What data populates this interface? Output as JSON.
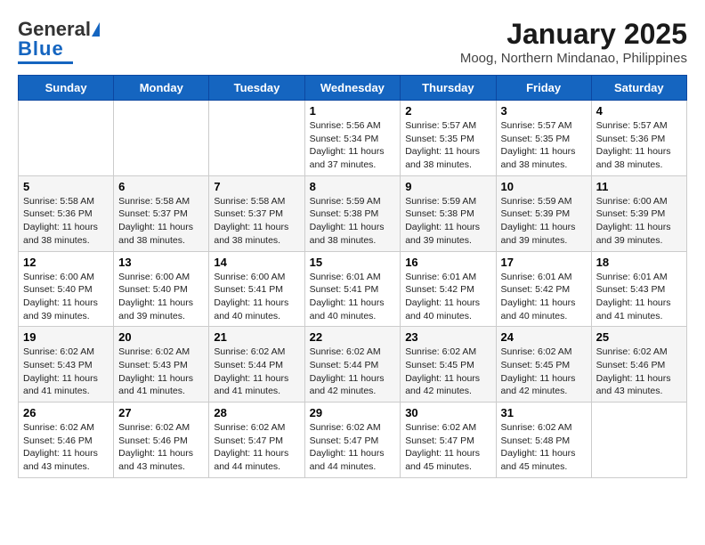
{
  "header": {
    "logo_general": "General",
    "logo_blue": "Blue",
    "title": "January 2025",
    "subtitle": "Moog, Northern Mindanao, Philippines"
  },
  "days_of_week": [
    "Sunday",
    "Monday",
    "Tuesday",
    "Wednesday",
    "Thursday",
    "Friday",
    "Saturday"
  ],
  "weeks": [
    [
      {
        "day": "",
        "info": ""
      },
      {
        "day": "",
        "info": ""
      },
      {
        "day": "",
        "info": ""
      },
      {
        "day": "1",
        "info": "Sunrise: 5:56 AM\nSunset: 5:34 PM\nDaylight: 11 hours\nand 37 minutes."
      },
      {
        "day": "2",
        "info": "Sunrise: 5:57 AM\nSunset: 5:35 PM\nDaylight: 11 hours\nand 38 minutes."
      },
      {
        "day": "3",
        "info": "Sunrise: 5:57 AM\nSunset: 5:35 PM\nDaylight: 11 hours\nand 38 minutes."
      },
      {
        "day": "4",
        "info": "Sunrise: 5:57 AM\nSunset: 5:36 PM\nDaylight: 11 hours\nand 38 minutes."
      }
    ],
    [
      {
        "day": "5",
        "info": "Sunrise: 5:58 AM\nSunset: 5:36 PM\nDaylight: 11 hours\nand 38 minutes."
      },
      {
        "day": "6",
        "info": "Sunrise: 5:58 AM\nSunset: 5:37 PM\nDaylight: 11 hours\nand 38 minutes."
      },
      {
        "day": "7",
        "info": "Sunrise: 5:58 AM\nSunset: 5:37 PM\nDaylight: 11 hours\nand 38 minutes."
      },
      {
        "day": "8",
        "info": "Sunrise: 5:59 AM\nSunset: 5:38 PM\nDaylight: 11 hours\nand 38 minutes."
      },
      {
        "day": "9",
        "info": "Sunrise: 5:59 AM\nSunset: 5:38 PM\nDaylight: 11 hours\nand 39 minutes."
      },
      {
        "day": "10",
        "info": "Sunrise: 5:59 AM\nSunset: 5:39 PM\nDaylight: 11 hours\nand 39 minutes."
      },
      {
        "day": "11",
        "info": "Sunrise: 6:00 AM\nSunset: 5:39 PM\nDaylight: 11 hours\nand 39 minutes."
      }
    ],
    [
      {
        "day": "12",
        "info": "Sunrise: 6:00 AM\nSunset: 5:40 PM\nDaylight: 11 hours\nand 39 minutes."
      },
      {
        "day": "13",
        "info": "Sunrise: 6:00 AM\nSunset: 5:40 PM\nDaylight: 11 hours\nand 39 minutes."
      },
      {
        "day": "14",
        "info": "Sunrise: 6:00 AM\nSunset: 5:41 PM\nDaylight: 11 hours\nand 40 minutes."
      },
      {
        "day": "15",
        "info": "Sunrise: 6:01 AM\nSunset: 5:41 PM\nDaylight: 11 hours\nand 40 minutes."
      },
      {
        "day": "16",
        "info": "Sunrise: 6:01 AM\nSunset: 5:42 PM\nDaylight: 11 hours\nand 40 minutes."
      },
      {
        "day": "17",
        "info": "Sunrise: 6:01 AM\nSunset: 5:42 PM\nDaylight: 11 hours\nand 40 minutes."
      },
      {
        "day": "18",
        "info": "Sunrise: 6:01 AM\nSunset: 5:43 PM\nDaylight: 11 hours\nand 41 minutes."
      }
    ],
    [
      {
        "day": "19",
        "info": "Sunrise: 6:02 AM\nSunset: 5:43 PM\nDaylight: 11 hours\nand 41 minutes."
      },
      {
        "day": "20",
        "info": "Sunrise: 6:02 AM\nSunset: 5:43 PM\nDaylight: 11 hours\nand 41 minutes."
      },
      {
        "day": "21",
        "info": "Sunrise: 6:02 AM\nSunset: 5:44 PM\nDaylight: 11 hours\nand 41 minutes."
      },
      {
        "day": "22",
        "info": "Sunrise: 6:02 AM\nSunset: 5:44 PM\nDaylight: 11 hours\nand 42 minutes."
      },
      {
        "day": "23",
        "info": "Sunrise: 6:02 AM\nSunset: 5:45 PM\nDaylight: 11 hours\nand 42 minutes."
      },
      {
        "day": "24",
        "info": "Sunrise: 6:02 AM\nSunset: 5:45 PM\nDaylight: 11 hours\nand 42 minutes."
      },
      {
        "day": "25",
        "info": "Sunrise: 6:02 AM\nSunset: 5:46 PM\nDaylight: 11 hours\nand 43 minutes."
      }
    ],
    [
      {
        "day": "26",
        "info": "Sunrise: 6:02 AM\nSunset: 5:46 PM\nDaylight: 11 hours\nand 43 minutes."
      },
      {
        "day": "27",
        "info": "Sunrise: 6:02 AM\nSunset: 5:46 PM\nDaylight: 11 hours\nand 43 minutes."
      },
      {
        "day": "28",
        "info": "Sunrise: 6:02 AM\nSunset: 5:47 PM\nDaylight: 11 hours\nand 44 minutes."
      },
      {
        "day": "29",
        "info": "Sunrise: 6:02 AM\nSunset: 5:47 PM\nDaylight: 11 hours\nand 44 minutes."
      },
      {
        "day": "30",
        "info": "Sunrise: 6:02 AM\nSunset: 5:47 PM\nDaylight: 11 hours\nand 45 minutes."
      },
      {
        "day": "31",
        "info": "Sunrise: 6:02 AM\nSunset: 5:48 PM\nDaylight: 11 hours\nand 45 minutes."
      },
      {
        "day": "",
        "info": ""
      }
    ]
  ]
}
